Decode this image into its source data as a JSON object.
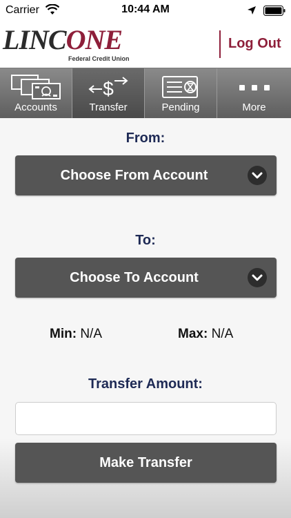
{
  "status_bar": {
    "carrier": "Carrier",
    "time": "10:44 AM",
    "icons": [
      "wifi-icon",
      "location-icon",
      "battery-icon"
    ]
  },
  "header": {
    "logo_main_prefix": "LINC",
    "logo_main_suffix": "ONE",
    "logo_sub": "Federal Credit Union",
    "logout_label": "Log Out"
  },
  "tabs": [
    {
      "label": "Accounts",
      "icon": "accounts-icon",
      "active": false
    },
    {
      "label": "Transfer",
      "icon": "transfer-icon",
      "active": true
    },
    {
      "label": "Pending",
      "icon": "pending-icon",
      "active": false
    },
    {
      "label": "More",
      "icon": "more-icon",
      "active": false
    }
  ],
  "form": {
    "from_label": "From:",
    "from_select": "Choose From Account",
    "to_label": "To:",
    "to_select": "Choose To Account",
    "min_label": "Min:",
    "min_value": "N/A",
    "max_label": "Max:",
    "max_value": "N/A",
    "amount_label": "Transfer Amount:",
    "amount_value": "",
    "amount_placeholder": "",
    "submit_label": "Make Transfer"
  },
  "colors": {
    "brand_maroon": "#8e1f3a",
    "label_navy": "#1e2a55",
    "button_gray": "#555555"
  }
}
